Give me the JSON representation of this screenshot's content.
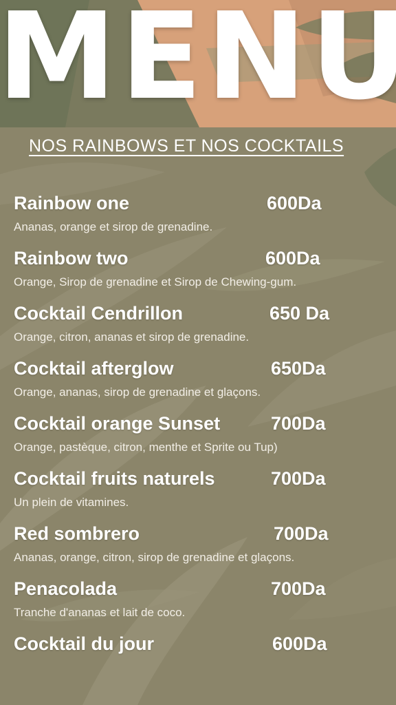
{
  "header": {
    "title": "MENU",
    "subtitle": "NOS RAINBOWS ET NOS COCKTAILS"
  },
  "colors": {
    "background": "#8b856a",
    "header_dark": "#6e7458",
    "header_peach": "#d7a17a",
    "text": "#ffffff"
  },
  "items": [
    {
      "name": "Rainbow one",
      "price": "600Da",
      "description": "Ananas, orange et sirop de grenadine."
    },
    {
      "name": "Rainbow two",
      "price": "600Da",
      "description": "Orange, Sirop de grenadine et Sirop de Chewing-gum."
    },
    {
      "name": "Cocktail Cendrillon",
      "price": "650 Da",
      "description": "Orange, citron, ananas et sirop de grenadine."
    },
    {
      "name": "Cocktail afterglow",
      "price": "650Da",
      "description": "Orange, ananas, sirop de grenadine et glaçons."
    },
    {
      "name": "Cocktail orange Sunset",
      "price": "700Da",
      "description": "Orange, pastèque, citron, menthe et Sprite ou Tup)"
    },
    {
      "name": "Cocktail fruits naturels",
      "price": "700Da",
      "description": "Un plein de vitamines."
    },
    {
      "name": "Red sombrero",
      "price": "700Da",
      "description": "Ananas, orange, citron, sirop de grenadine et glaçons."
    },
    {
      "name": "Penacolada",
      "price": "700Da",
      "description": "Tranche d'ananas et lait de coco."
    },
    {
      "name": "Cocktail du jour",
      "price": "600Da",
      "description": ""
    }
  ]
}
